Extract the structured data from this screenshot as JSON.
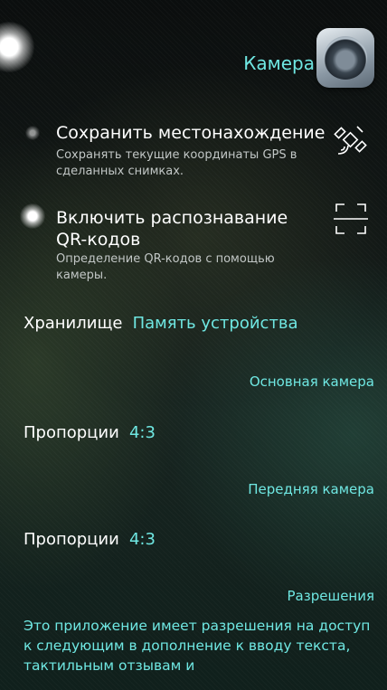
{
  "header": {
    "title": "Камера",
    "app_icon": "camera-lens-icon"
  },
  "settings": {
    "location": {
      "title": "Сохранить местонахождение",
      "subtitle": "Сохранять текущие координаты GPS в сделанных снимках.",
      "icon": "satellite-icon",
      "enabled": false
    },
    "qr": {
      "title": "Включить распознавание QR-кодов",
      "subtitle": "Определение QR-кодов с помощью камеры.",
      "icon": "qr-scan-icon",
      "enabled": true
    }
  },
  "storage": {
    "label": "Хранилище",
    "value": "Память устройства"
  },
  "main_camera": {
    "section": "Основная камера",
    "aspect_label": "Пропорции",
    "aspect_value": "4:3"
  },
  "front_camera": {
    "section": "Передняя камера",
    "aspect_label": "Пропорции",
    "aspect_value": "4:3"
  },
  "permissions": {
    "section": "Разрешения",
    "text": "Это приложение имеет разрешения на доступ к следующим в дополнение к вводу текста, тактильным отзывам и"
  },
  "colors": {
    "accent": "#6fe7e2",
    "subtitle": "#c2c7c6"
  }
}
